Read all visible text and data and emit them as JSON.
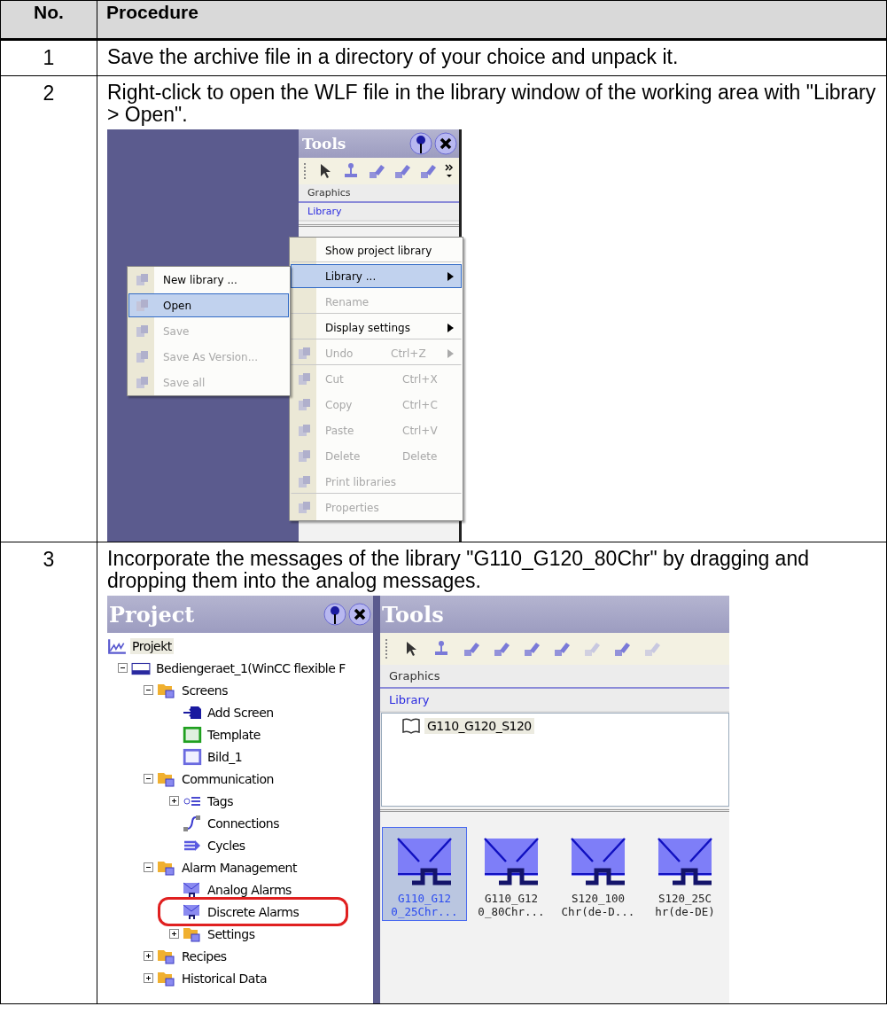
{
  "table": {
    "columns": [
      "No.",
      "Procedure"
    ],
    "rows": [
      {
        "number": "1",
        "text": "Save the archive file in a directory of your choice and unpack it."
      },
      {
        "number": "2",
        "text": "Right-click to open the WLF file in the library window of the working area with \"Library > Open\".",
        "screenshot": {
          "kind": "menu",
          "tools": {
            "title": "Tools",
            "sections": [
              {
                "label": "Graphics",
                "selected": false
              },
              {
                "label": "Library",
                "selected": true
              }
            ]
          },
          "context_menu": [
            {
              "label": "Show project library",
              "icon": false,
              "disabled": false,
              "submenu": false,
              "selected": false,
              "separator_after": true
            },
            {
              "label": "Library ...",
              "icon": false,
              "disabled": false,
              "submenu": true,
              "selected": true,
              "separator_after": false
            },
            {
              "label": "Rename",
              "icon": false,
              "disabled": true,
              "submenu": false,
              "selected": false,
              "separator_after": true
            },
            {
              "label": "Display settings",
              "icon": false,
              "disabled": false,
              "submenu": true,
              "selected": false,
              "separator_after": true
            },
            {
              "label": "Undo",
              "shortcut": "Ctrl+Z",
              "icon": true,
              "disabled": true,
              "submenu": true,
              "selected": false,
              "separator_after": true
            },
            {
              "label": "Cut",
              "shortcut": "Ctrl+X",
              "icon": true,
              "disabled": true,
              "submenu": false,
              "selected": false,
              "separator_after": false
            },
            {
              "label": "Copy",
              "shortcut": "Ctrl+C",
              "icon": true,
              "disabled": true,
              "submenu": false,
              "selected": false,
              "separator_after": false
            },
            {
              "label": "Paste",
              "shortcut": "Ctrl+V",
              "icon": true,
              "disabled": true,
              "submenu": false,
              "selected": false,
              "separator_after": false
            },
            {
              "label": "Delete",
              "shortcut": "Delete",
              "icon": true,
              "disabled": true,
              "submenu": false,
              "selected": false,
              "separator_after": false
            },
            {
              "label": "Print libraries",
              "icon": true,
              "disabled": true,
              "submenu": false,
              "selected": false,
              "separator_after": true
            },
            {
              "label": "Properties",
              "icon": true,
              "disabled": true,
              "submenu": false,
              "selected": false,
              "separator_after": false
            }
          ],
          "submenu": [
            {
              "label": "New library ...",
              "disabled": false,
              "selected": false
            },
            {
              "label": "Open",
              "disabled": false,
              "selected": true
            },
            {
              "label": "Save",
              "disabled": true,
              "selected": false
            },
            {
              "label": "Save As Version...",
              "disabled": true,
              "selected": false
            },
            {
              "label": "Save all",
              "disabled": true,
              "selected": false
            }
          ]
        }
      },
      {
        "number": "3",
        "text": "Incorporate the messages of the library \"G110_G120_80Chr\" by dragging and dropping them into the analog messages.",
        "screenshot": {
          "kind": "drag",
          "project": {
            "title": "Project",
            "tree": [
              {
                "label": "Projekt",
                "kind": "project",
                "selected": true,
                "children": [
                  {
                    "label": "Bediengeraet_1(WinCC flexible F",
                    "kind": "device",
                    "expanded": true,
                    "children": [
                      {
                        "label": "Screens",
                        "kind": "folder",
                        "expanded": true,
                        "children": [
                          {
                            "label": "Add Screen",
                            "kind": "add"
                          },
                          {
                            "label": "Template",
                            "kind": "template"
                          },
                          {
                            "label": "Bild_1",
                            "kind": "screen"
                          }
                        ]
                      },
                      {
                        "label": "Communication",
                        "kind": "folder",
                        "expanded": true,
                        "children": [
                          {
                            "label": "Tags",
                            "kind": "tags",
                            "expanded": false
                          },
                          {
                            "label": "Connections",
                            "kind": "link"
                          },
                          {
                            "label": "Cycles",
                            "kind": "cycles"
                          }
                        ]
                      },
                      {
                        "label": "Alarm Management",
                        "kind": "folder",
                        "expanded": true,
                        "children": [
                          {
                            "label": "Analog Alarms",
                            "kind": "alarm"
                          },
                          {
                            "label": "Discrete Alarms",
                            "kind": "alarm"
                          },
                          {
                            "label": "Settings",
                            "kind": "folder",
                            "expanded": false
                          }
                        ]
                      },
                      {
                        "label": "Recipes",
                        "kind": "folder",
                        "expanded": false
                      },
                      {
                        "label": "Historical Data",
                        "kind": "folder",
                        "expanded": false
                      }
                    ]
                  }
                ]
              }
            ]
          },
          "tools": {
            "title": "Tools",
            "sections": [
              {
                "label": "Graphics",
                "selected": false
              },
              {
                "label": "Library",
                "selected": true
              }
            ],
            "library": "G110_G120_S120",
            "items": [
              {
                "lines": [
                  "G110_G12",
                  "0_25Chr..."
                ],
                "selected": true
              },
              {
                "lines": [
                  "G110_G12",
                  "0_80Chr..."
                ],
                "selected": false
              },
              {
                "lines": [
                  "S120_100",
                  "Chr(de-D..."
                ],
                "selected": false
              },
              {
                "lines": [
                  "S120_25C",
                  "hr(de-DE)"
                ],
                "selected": false
              }
            ]
          }
        }
      }
    ]
  }
}
